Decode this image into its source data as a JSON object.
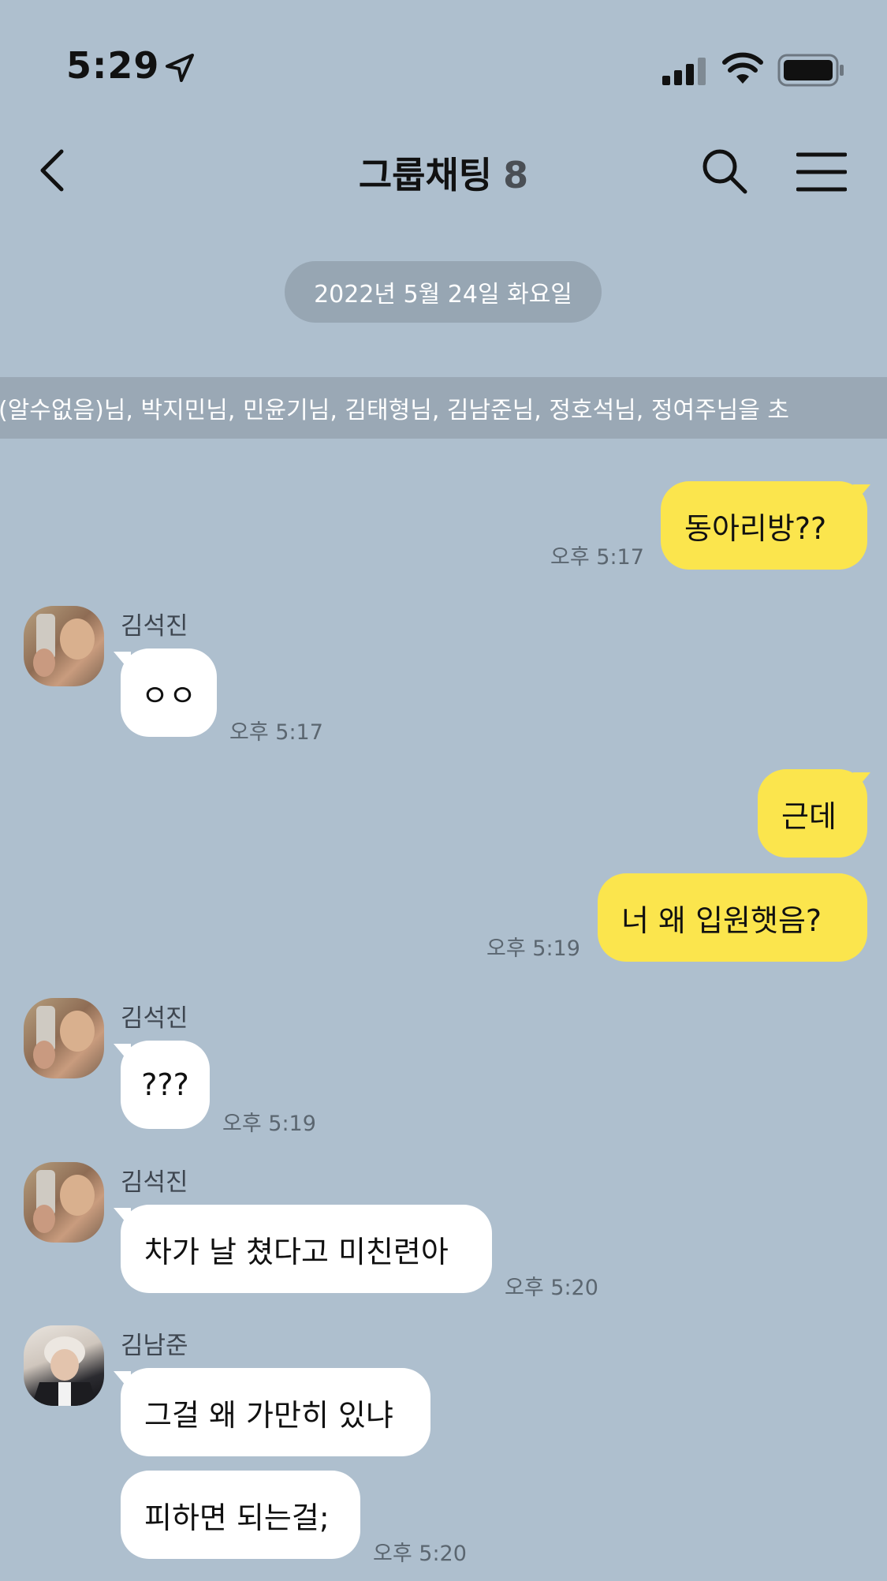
{
  "status_bar": {
    "time": "5:29"
  },
  "header": {
    "title": "그룹채팅",
    "member_count": "8"
  },
  "date_divider": "2022년 5월 24일 화요일",
  "invite_notice": "(알수없음)님, 박지민님, 민윤기님, 김태형님, 김남준님, 정호석님, 정여주님을 초",
  "messages": [
    {
      "from": "me",
      "text": "동아리방??",
      "time": "오후 5:17"
    },
    {
      "from": "김석진",
      "text": "ㅇㅇ",
      "time": "오후 5:17"
    },
    {
      "from": "me",
      "text": "근데"
    },
    {
      "from": "me",
      "text": "너 왜 입원햇음?",
      "time": "오후 5:19"
    },
    {
      "from": "김석진",
      "text": "???",
      "time": "오후 5:19"
    },
    {
      "from": "김석진",
      "text": "차가 날 쳤다고 미친련아",
      "time": "오후 5:20"
    },
    {
      "from": "김남준",
      "text": "그걸 왜 가만히 있냐"
    },
    {
      "from": "김남준",
      "text": "피하면 되는걸;",
      "time": "오후 5:20"
    }
  ],
  "colors": {
    "background": "#aebfce",
    "my_bubble": "#fbe54d",
    "their_bubble": "#ffffff"
  }
}
